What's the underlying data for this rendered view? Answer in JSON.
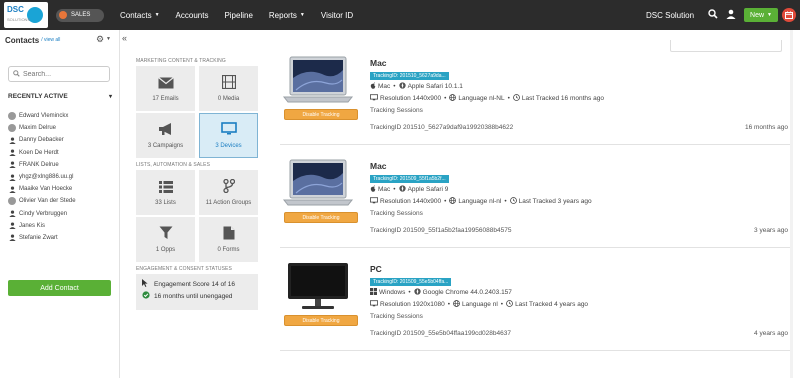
{
  "header": {
    "logo_text": "DSC",
    "logo_sub": "SOLUTIONS",
    "sales_label": "SALES",
    "nav": [
      {
        "label": "Contacts",
        "dropdown": true
      },
      {
        "label": "Accounts",
        "dropdown": false
      },
      {
        "label": "Pipeline",
        "dropdown": false
      },
      {
        "label": "Reports",
        "dropdown": true
      },
      {
        "label": "Visitor ID",
        "dropdown": false
      }
    ],
    "org_name": "DSC Solution",
    "new_label": "New",
    "accent_green": "#5ab036",
    "icons": [
      "search-icon",
      "user-icon",
      "calendar-icon"
    ]
  },
  "sidebar": {
    "title": "Contacts",
    "view_all": "/ view all",
    "search_placeholder": "Search...",
    "recently_active_title": "RECENTLY ACTIVE",
    "recently_active": [
      {
        "name": "Edward Vleminckx",
        "icon": "avatar"
      },
      {
        "name": "Maxim Delrue",
        "icon": "avatar"
      },
      {
        "name": "Danny Debacker",
        "icon": "person-icon"
      },
      {
        "name": "Koen De Herdt",
        "icon": "person-icon"
      },
      {
        "name": "FRANK Delrue",
        "icon": "person-icon"
      },
      {
        "name": "yhgz@xlng886.uu.gl",
        "icon": "person-icon"
      },
      {
        "name": "Maaike Van Hoecke",
        "icon": "person-icon"
      },
      {
        "name": "Olivier Van der Stede",
        "icon": "avatar"
      },
      {
        "name": "Cindy Verbruggen",
        "icon": "person-icon"
      },
      {
        "name": "Janes Kis",
        "icon": "person-icon"
      },
      {
        "name": "Stefanie Zwart",
        "icon": "person-icon"
      }
    ],
    "add_contact_label": "Add Contact"
  },
  "middle": {
    "section1_title": "MARKETING CONTENT & TRACKING",
    "section2_title": "LISTS, AUTOMATION & SALES",
    "section3_title": "ENGAGEMENT & CONSENT STATUSES",
    "tiles": [
      {
        "label": "17 Emails",
        "icon": "envelope-icon"
      },
      {
        "label": "0 Media",
        "icon": "film-icon"
      },
      {
        "label": "3 Campaigns",
        "icon": "megaphone-icon"
      },
      {
        "label": "3 Devices",
        "icon": "monitor-icon",
        "active": true
      },
      {
        "label": "33 Lists",
        "icon": "list-icon"
      },
      {
        "label": "11 Action Groups",
        "icon": "branch-icon"
      },
      {
        "label": "1 Opps",
        "icon": "filter-icon"
      },
      {
        "label": "0 Forms",
        "icon": "document-icon"
      }
    ],
    "engagement_score": "Engagement Score 14 of 16",
    "engagement_until": "16 months until unengaged"
  },
  "devices": [
    {
      "name": "Mac",
      "type": "laptop",
      "tracking_badge": "TrackingID: 201510_5627a9da...",
      "os": "Mac",
      "browser": "Apple Safari 10.1.1",
      "resolution": "Resolution 1440x900",
      "language": "Language nl-NL",
      "last_tracked": "Last Tracked 16 months ago",
      "sessions_label": "Tracking Sessions",
      "tracking_id": "TrackingID 201510_5627a9daf9a19920388b4622",
      "tracking_ago": "16 months ago",
      "disable_label": "Disable Tracking"
    },
    {
      "name": "Mac",
      "type": "laptop",
      "tracking_badge": "TrackingID: 201509_55f1a5b2f...",
      "os": "Mac",
      "browser": "Apple Safari 9",
      "resolution": "Resolution 1440x900",
      "language": "Language nl-nl",
      "last_tracked": "Last Tracked 3 years ago",
      "sessions_label": "Tracking Sessions",
      "tracking_id": "TrackingID 201509_55f1a5b2faa19956088b4575",
      "tracking_ago": "3 years ago",
      "disable_label": "Disable Tracking"
    },
    {
      "name": "PC",
      "type": "monitor",
      "tracking_badge": "TrackingID: 201509_55e5b04ffa...",
      "os": "Windows",
      "browser": "Google Chrome 44.0.2403.157",
      "resolution": "Resolution 1920x1080",
      "language": "Language nl",
      "last_tracked": "Last Tracked 4 years ago",
      "sessions_label": "Tracking Sessions",
      "tracking_id": "TrackingID 201509_55e5b04ffaa199cd028b4637",
      "tracking_ago": "4 years ago",
      "disable_label": "Disable Tracking"
    }
  ]
}
